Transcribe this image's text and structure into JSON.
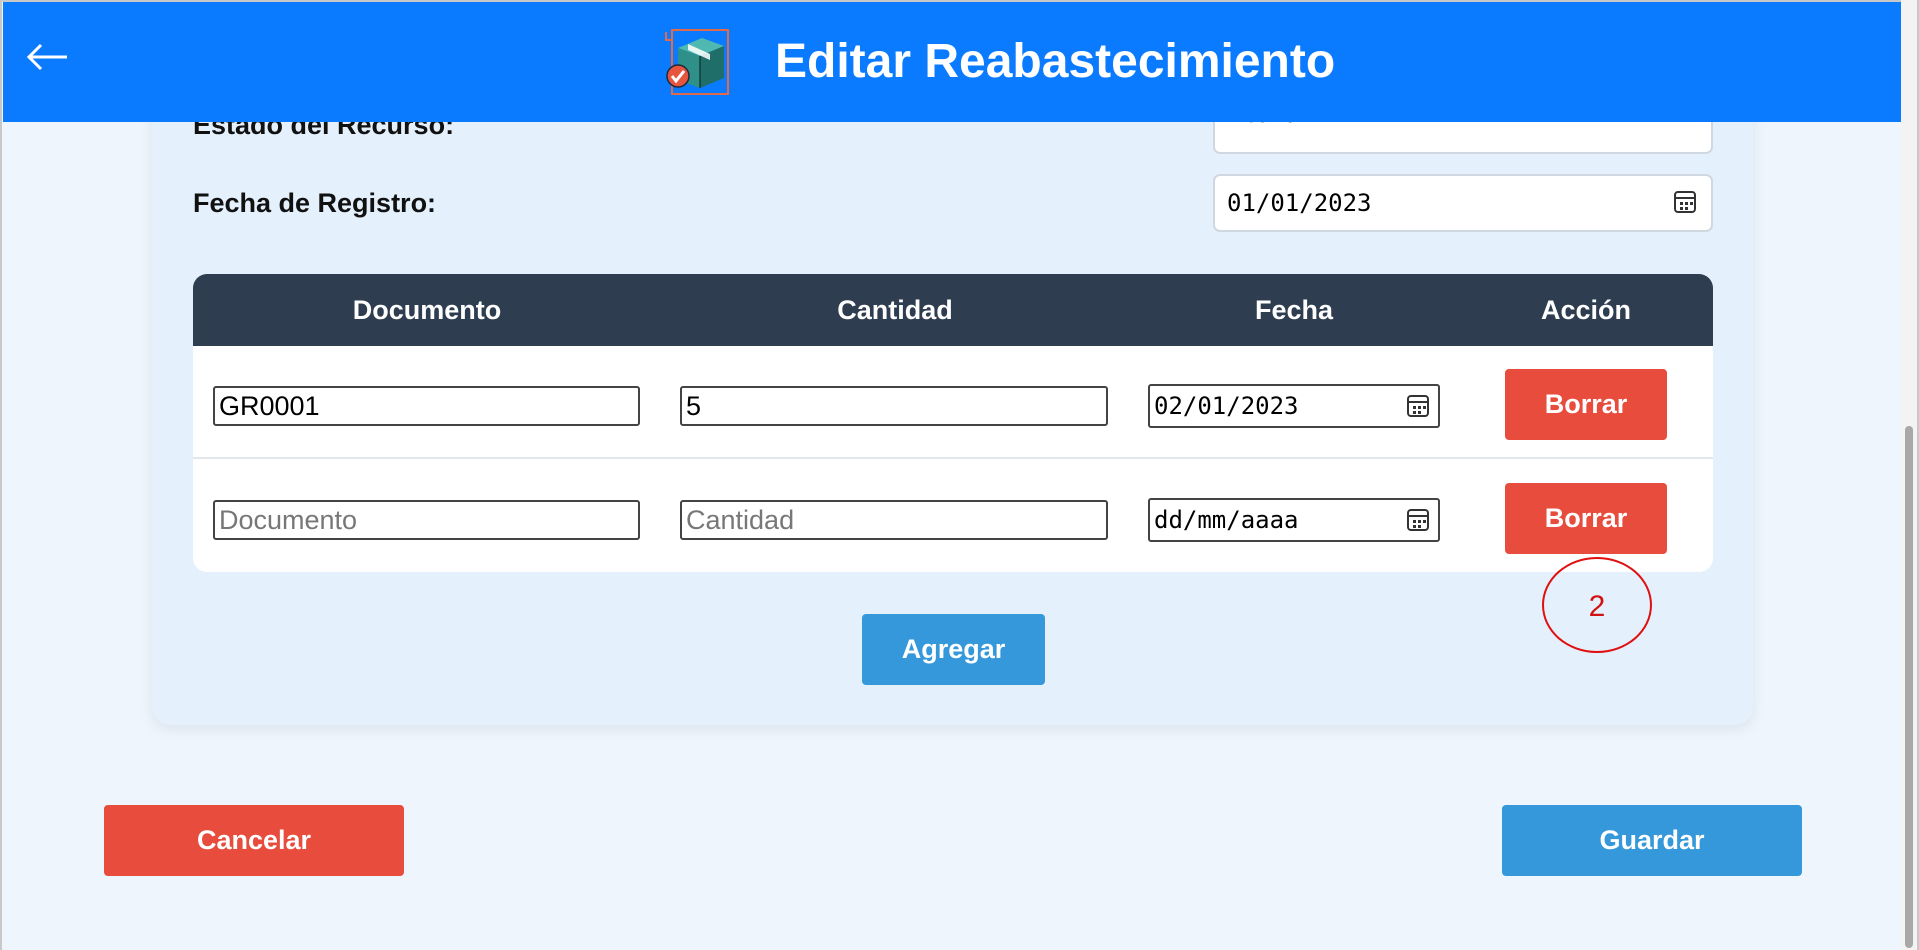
{
  "header": {
    "title": "Editar Reabastecimiento",
    "back_icon": "arrow-left-icon",
    "logo_icon": "box-restock-icon",
    "color": "#0a7bff"
  },
  "form": {
    "estado_label": "Estado del Recurso:",
    "estado_value": "Activo",
    "fecha_label": "Fecha de Registro:",
    "fecha_value": "01/01/2023"
  },
  "table": {
    "headers": [
      "Documento",
      "Cantidad",
      "Fecha",
      "Acción"
    ],
    "rows": [
      {
        "documento": "GR0001",
        "cantidad": "5",
        "fecha": "02/01/2023",
        "accion": "Borrar"
      },
      {
        "documento_placeholder": "Documento",
        "cantidad_placeholder": "Cantidad",
        "fecha_placeholder": "dd/mm/aaaa",
        "accion": "Borrar"
      }
    ]
  },
  "buttons": {
    "agregar": "Agregar",
    "cancelar": "Cancelar",
    "guardar": "Guardar"
  },
  "annotation": {
    "text": "2",
    "color": "#e01010"
  },
  "colors": {
    "danger": "#e74c3c",
    "primary": "#3498db",
    "table_header": "#2e3e50"
  }
}
